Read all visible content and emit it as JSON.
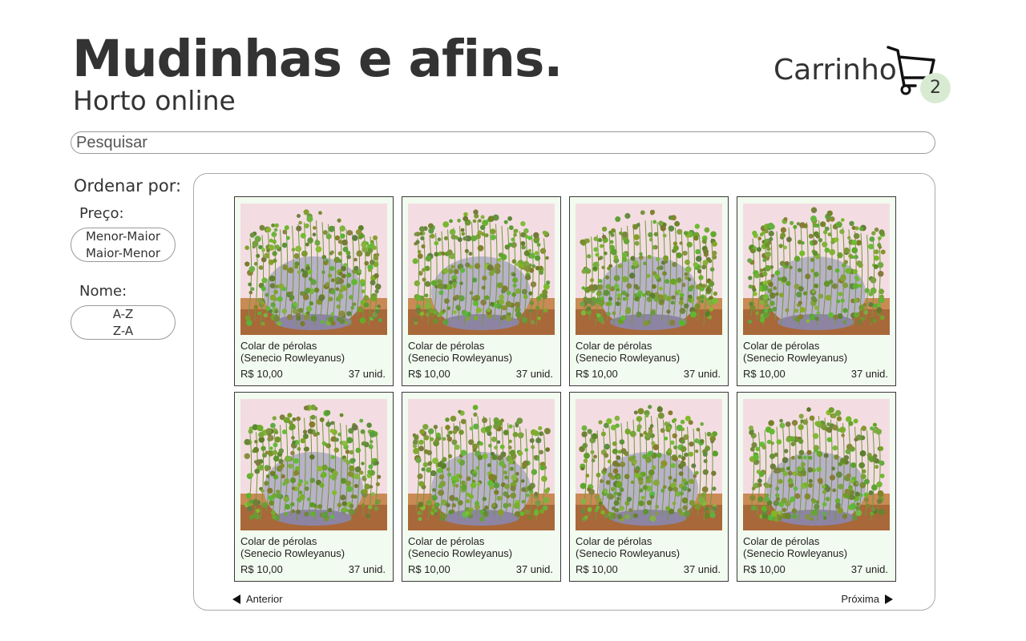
{
  "header": {
    "title": "Mudinhas e afins.",
    "subtitle": "Horto online",
    "cart_label": "Carrinho",
    "cart_count": "2",
    "cart_icon": "shopping-cart-icon",
    "badge_color": "#d9ead3"
  },
  "search": {
    "placeholder": "Pesquisar"
  },
  "sort": {
    "title": "Ordenar por:",
    "price_label": "Preço:",
    "price_options": [
      "Menor-Maior",
      "Maior-Menor"
    ],
    "name_label": "Nome:",
    "name_options": [
      "A-Z",
      "Z-A"
    ]
  },
  "products": [
    {
      "name": "Colar de pérolas\n(Senecio Rowleyanus)",
      "price": "R$ 10,00",
      "stock": "37 unid."
    },
    {
      "name": "Colar de pérolas\n(Senecio Rowleyanus)",
      "price": "R$ 10,00",
      "stock": "37 unid."
    },
    {
      "name": "Colar de pérolas\n(Senecio Rowleyanus)",
      "price": "R$ 10,00",
      "stock": "37 unid."
    },
    {
      "name": "Colar de pérolas\n(Senecio Rowleyanus)",
      "price": "R$ 10,00",
      "stock": "37 unid."
    },
    {
      "name": "Colar de pérolas\n(Senecio Rowleyanus)",
      "price": "R$ 10,00",
      "stock": "37 unid."
    },
    {
      "name": "Colar de pérolas\n(Senecio Rowleyanus)",
      "price": "R$ 10,00",
      "stock": "37 unid."
    },
    {
      "name": "Colar de pérolas\n(Senecio Rowleyanus)",
      "price": "R$ 10,00",
      "stock": "37 unid."
    },
    {
      "name": "Colar de pérolas\n(Senecio Rowleyanus)",
      "price": "R$ 10,00",
      "stock": "37 unid."
    }
  ],
  "pagination": {
    "prev_label": "Anterior",
    "next_label": "Próxima"
  },
  "colors": {
    "card_background": "#f2fbef",
    "card_border": "#3a3a3a",
    "text": "#333333"
  }
}
